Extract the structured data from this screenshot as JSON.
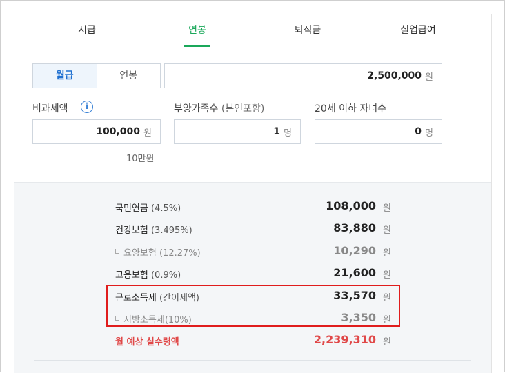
{
  "tabs": [
    {
      "label": "시급"
    },
    {
      "label": "연봉"
    },
    {
      "label": "퇴직금"
    },
    {
      "label": "실업급여"
    }
  ],
  "pay_type": {
    "monthly": "월급",
    "annual": "연봉"
  },
  "salary": {
    "value": "2,500,000",
    "unit": "원"
  },
  "nontax": {
    "label": "비과세액",
    "icon": "i",
    "value": "100,000",
    "unit": "원",
    "hint": "10만원"
  },
  "dependents": {
    "label": "부양가족수",
    "sub": "(본인포함)",
    "value": "1",
    "unit": "명"
  },
  "children": {
    "label": "20세 이하 자녀수",
    "value": "0",
    "unit": "명"
  },
  "results": [
    {
      "label": "국민연금",
      "pct": "(4.5%)",
      "amount": "108,000",
      "unit": "원"
    },
    {
      "label": "건강보험",
      "pct": "(3.495%)",
      "amount": "83,880",
      "unit": "원"
    },
    {
      "label": "요양보험",
      "pct": "(12.27%)",
      "amount": "10,290",
      "unit": "원"
    },
    {
      "label": "고용보험",
      "pct": "(0.9%)",
      "amount": "21,600",
      "unit": "원"
    },
    {
      "label": "근로소득세",
      "pct": "(간이세액)",
      "amount": "33,570",
      "unit": "원"
    },
    {
      "label": "지방소득세",
      "pct": "(10%)",
      "amount": "3,350",
      "unit": "원"
    },
    {
      "label": "월 예상 실수령액",
      "pct": "",
      "amount": "2,239,310",
      "unit": "원"
    }
  ],
  "colors": {
    "accent": "#1aa85a",
    "blue": "#1e6fd0",
    "net": "#e04848",
    "highlight": "#e01d1d"
  }
}
